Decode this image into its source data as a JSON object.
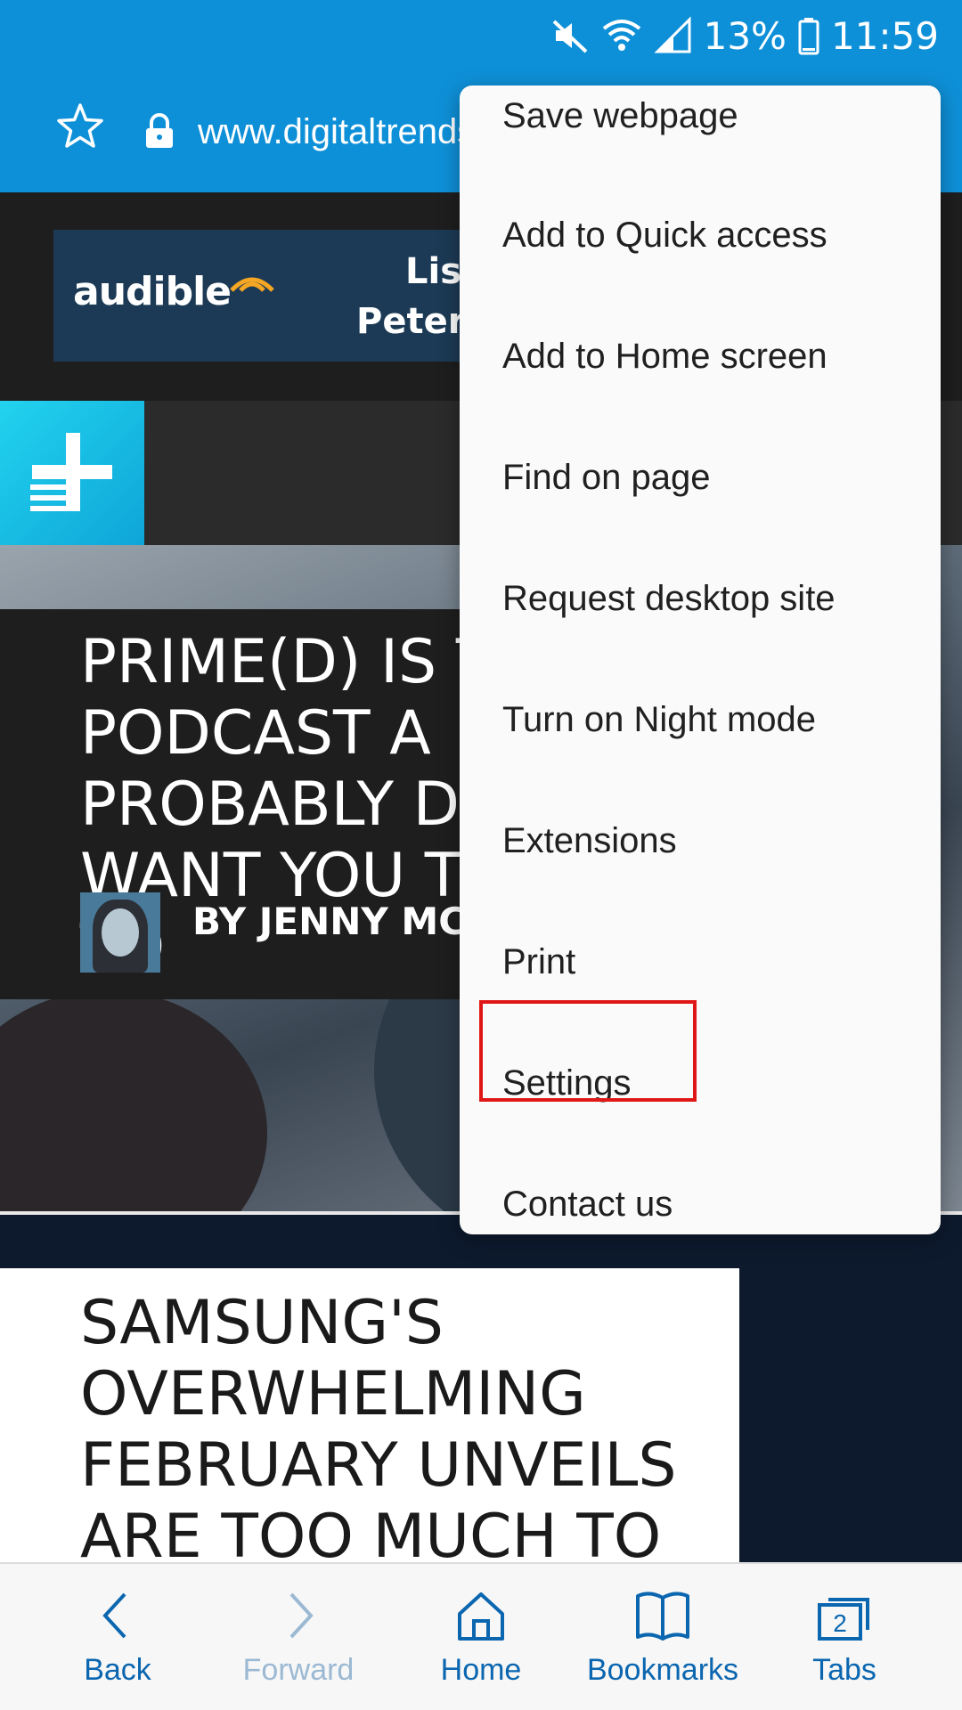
{
  "status_bar": {
    "battery": "13%",
    "time": "11:59"
  },
  "address_bar": {
    "url": "www.digitaltrends"
  },
  "page": {
    "ad": {
      "brand": "audible",
      "line1": "List",
      "line2": "Peter Cro"
    },
    "hero": {
      "title": "PRIME(D) IS T\nPODCAST A\nPROBABLY D\nWANT YOU T\nTO",
      "author": "BY JENNY MC"
    },
    "article2": {
      "title": "SAMSUNG'S\nOVERWHELMING\nFEBRUARY UNVEILS\nARE TOO MUCH TO"
    }
  },
  "menu": {
    "items": [
      {
        "label": "Save webpage"
      },
      {
        "label": "Add to Quick access"
      },
      {
        "label": "Add to Home screen"
      },
      {
        "label": "Find on page"
      },
      {
        "label": "Request desktop site"
      },
      {
        "label": "Turn on Night mode"
      },
      {
        "label": "Extensions"
      },
      {
        "label": "Print"
      },
      {
        "label": "Settings"
      },
      {
        "label": "Contact us"
      }
    ],
    "highlighted": "Settings",
    "highlight_color": "#e01717"
  },
  "bottom_nav": {
    "items": [
      {
        "label": "Back",
        "icon": "chevron-left-icon",
        "enabled": true
      },
      {
        "label": "Forward",
        "icon": "chevron-right-icon",
        "enabled": false
      },
      {
        "label": "Home",
        "icon": "home-icon",
        "enabled": true
      },
      {
        "label": "Bookmarks",
        "icon": "book-icon",
        "enabled": true
      },
      {
        "label": "Tabs",
        "icon": "tabs-icon",
        "enabled": true,
        "count": "2"
      }
    ]
  },
  "colors": {
    "chrome_blue": "#0e90d8",
    "nav_text": "#0b66b0"
  }
}
